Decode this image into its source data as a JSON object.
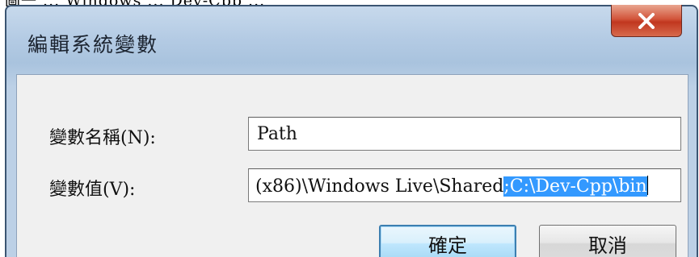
{
  "caption": "圖一 ... Windows ... Dev-Cpp ...",
  "window": {
    "title": "編輯系統變數",
    "close_icon": "close-icon"
  },
  "form": {
    "name_label": "變數名稱(N):",
    "name_value": "Path",
    "value_label": "變數值(V):",
    "value_text_unselected": "(x86)\\Windows Live\\Shared",
    "value_text_selected": ";C:\\Dev-Cpp\\bin"
  },
  "buttons": {
    "ok_label": "確定",
    "cancel_label": "取消"
  },
  "colors": {
    "selection": "#3399ff",
    "close_button": "#c1371f",
    "frame": "#b4cbe4"
  }
}
